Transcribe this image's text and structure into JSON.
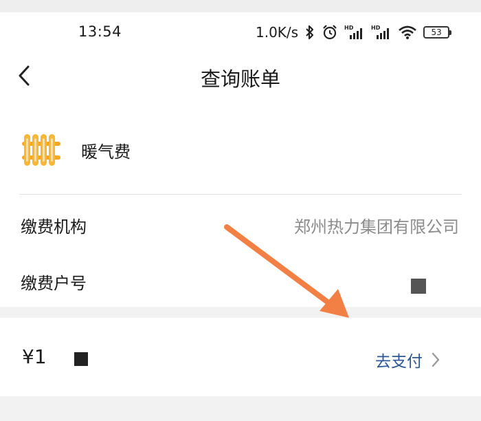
{
  "status_bar": {
    "time": "13:54",
    "net_speed": "1.0K/s",
    "battery_level": "53",
    "icons": [
      "bluetooth-icon",
      "alarm-icon",
      "hd-signal-icon",
      "hd-signal-icon",
      "wifi-icon",
      "battery-icon"
    ]
  },
  "nav": {
    "title": "查询账单",
    "back_icon": "chevron-left-icon"
  },
  "bill": {
    "category_icon": "radiator-icon",
    "category": "暖气费",
    "fields": [
      {
        "label": "缴费机构",
        "value": "郑州热力集团有限公司"
      },
      {
        "label": "缴费户号",
        "value": ""
      }
    ]
  },
  "payment": {
    "amount": "¥1",
    "pay_label": "去支付",
    "pay_icon": "chevron-right-icon"
  },
  "colors": {
    "accent_blue": "#2b5797",
    "radiator_orange": "#f5a623",
    "annotation_arrow": "#f28044"
  }
}
